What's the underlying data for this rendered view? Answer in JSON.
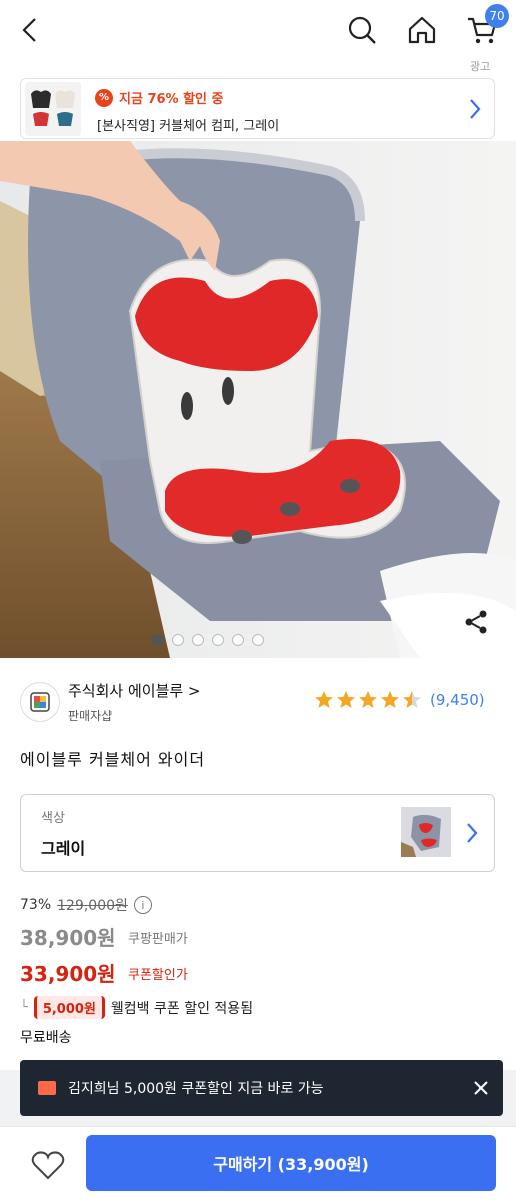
{
  "header": {
    "cart_count": "70",
    "ad_label": "광고"
  },
  "ad_banner": {
    "promo_text": "지금 76% 할인 중",
    "product_title": "[본사직영] 커블체어 컴피, 그레이"
  },
  "seller": {
    "name": "주식회사 에이블루 >",
    "subtitle": "판매자샵",
    "rating_count": "(9,450)",
    "rating_value": 4.5
  },
  "product": {
    "title": "에이블루 커블체어 와이더"
  },
  "option": {
    "label": "색상",
    "value": "그레이"
  },
  "price": {
    "discount_rate": "73%",
    "original_price": "129,000원",
    "coupang_price": "38,900원",
    "coupang_price_label": "쿠팡판매가",
    "coupon_price": "33,900원",
    "coupon_price_label": "쿠폰할인가",
    "coupon_amount": "5,000원",
    "coupon_note": "웰컴백 쿠폰 할인 적용됨",
    "shipping": "무료배송"
  },
  "toast": {
    "message": "김지희님 5,000원 쿠폰할인 지금 바로 가능"
  },
  "bottom_bar": {
    "buy_label": "구매하기 (33,900원)"
  },
  "carousel": {
    "total": 6,
    "active_index": 0
  },
  "colors": {
    "accent_blue": "#3a6ff2",
    "coupon_red": "#d6220f",
    "toast_bg": "#1d2631"
  }
}
